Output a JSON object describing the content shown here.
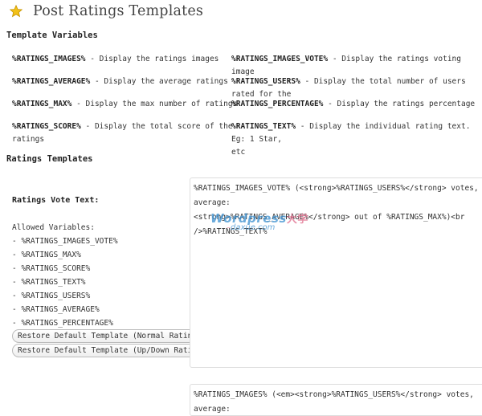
{
  "page": {
    "title": "Post Ratings Templates"
  },
  "sections": {
    "template_variables": "Template Variables",
    "ratings_templates": "Ratings Templates"
  },
  "variables": [
    {
      "name": "%RATINGS_IMAGES%",
      "desc": " - Display the ratings images"
    },
    {
      "name": "%RATINGS_IMAGES_VOTE%",
      "desc": " - Display the ratings voting image"
    },
    {
      "name": "%RATINGS_AVERAGE%",
      "desc": " - Display the average ratings"
    },
    {
      "name": "%RATINGS_USERS%",
      "desc": " - Display the total number of users rated for the"
    },
    {
      "name": "%RATINGS_MAX%",
      "desc": " - Display the max number of ratings"
    },
    {
      "name": "%RATINGS_PERCENTAGE%",
      "desc": " - Display the ratings percentage"
    },
    {
      "name": "%RATINGS_SCORE%",
      "desc": " - Display the total score of the",
      "desc2": "ratings"
    },
    {
      "name": "%RATINGS_TEXT%",
      "desc": " - Display the individual rating text. Eg: 1 Star,",
      "desc2": "etc"
    }
  ],
  "vote_text": {
    "label": "Ratings Vote Text:",
    "allowed_label": "Allowed Variables:",
    "allowed": [
      "- %RATINGS_IMAGES_VOTE%",
      "- %RATINGS_MAX%",
      "- %RATINGS_SCORE%",
      "- %RATINGS_TEXT%",
      "- %RATINGS_USERS%",
      "- %RATINGS_AVERAGE%",
      "- %RATINGS_PERCENTAGE%"
    ],
    "restore_normal": "Restore Default Template (Normal Rating)",
    "restore_updown": "Restore Default Template (Up/Down Rating)",
    "template_value": "%RATINGS_IMAGES_VOTE% (<strong>%RATINGS_USERS%</strong> votes, average:\n<strong>%RATINGS_AVERAGE%</strong> out of %RATINGS_MAX%)<br />%RATINGS_TEXT%"
  },
  "second_template": {
    "value": "%RATINGS_IMAGES% (<em><strong>%RATINGS_USERS%</strong> votes, average:"
  },
  "watermark": {
    "line1": "Wordpress",
    "line1_cn": "大学",
    "line2": "daxue.com"
  },
  "icons": {
    "title_icon": "star-icon"
  },
  "colors": {
    "star": "#f2c118",
    "star_stroke": "#c79400"
  }
}
